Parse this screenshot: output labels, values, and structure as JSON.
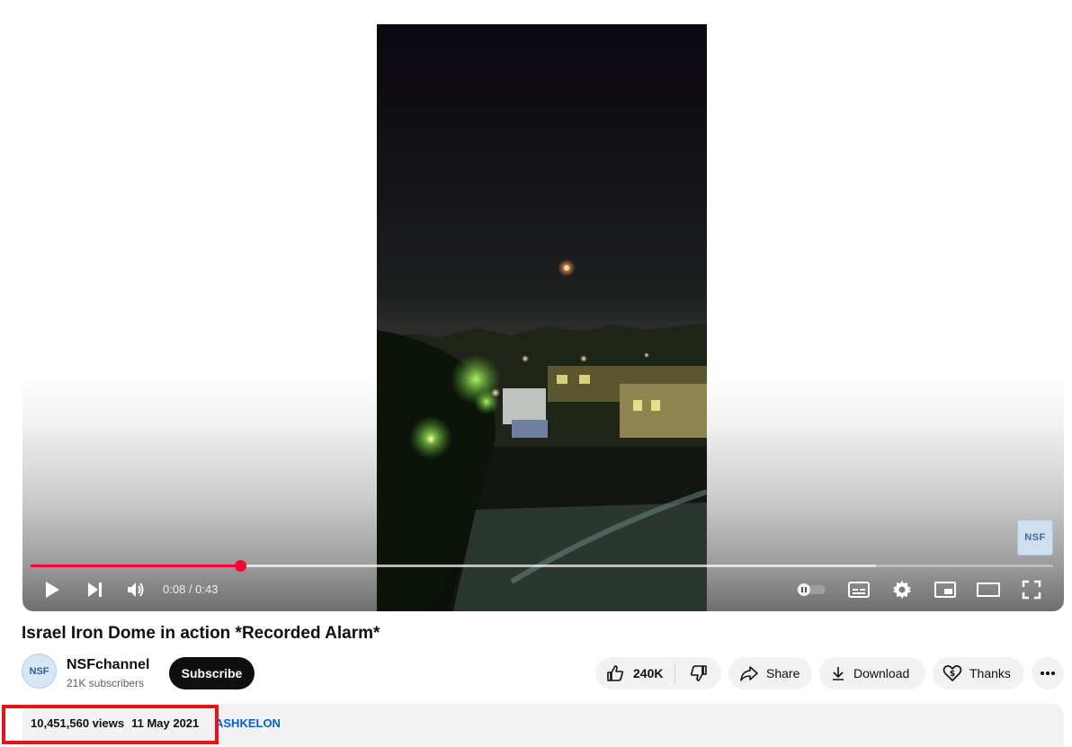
{
  "video": {
    "title": "Israel Iron Dome in action *Recorded Alarm*",
    "current_time": "0:08",
    "duration": "0:43",
    "time_display": "0:08 / 0:43",
    "progress_played": 0.205,
    "progress_loaded": 0.827,
    "watermark": "NSF"
  },
  "controls": {
    "icons": [
      "play-icon",
      "next-icon",
      "volume-icon",
      "autoplay-toggle-icon",
      "subtitles-icon",
      "settings-icon",
      "miniplayer-icon",
      "theater-icon",
      "fullscreen-icon"
    ]
  },
  "channel": {
    "name": "NSFchannel",
    "subscribers": "21K subscribers",
    "avatar_text": "NSF",
    "subscribe_label": "Subscribe"
  },
  "actions": {
    "like_count": "240K",
    "share_label": "Share",
    "download_label": "Download",
    "thanks_label": "Thanks"
  },
  "description": {
    "views": "10,451,560 views",
    "date": "11 May 2021",
    "hashtag": "ASHKELON"
  },
  "colors": {
    "accent": "#ff0033",
    "highlight": "#e8121a",
    "link": "#065fd4"
  }
}
